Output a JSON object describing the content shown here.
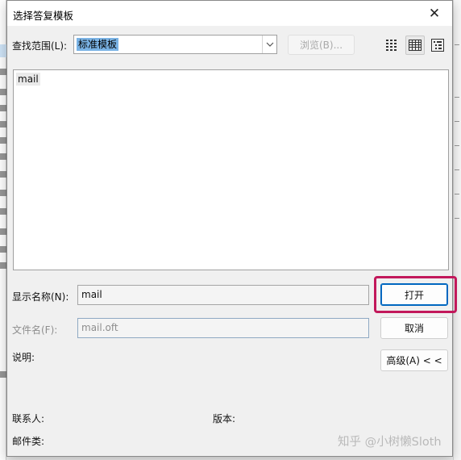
{
  "dialog": {
    "title": "选择答复模板",
    "close_glyph": "✕"
  },
  "lookin": {
    "label": "查找范围(L):",
    "selected": "标准模板",
    "browse_label": "浏览(B)..."
  },
  "view_buttons": [
    "list-view-icon",
    "details-view-icon",
    "tree-view-icon"
  ],
  "file_list": {
    "items": [
      "mail"
    ]
  },
  "display_name": {
    "label": "显示名称(N):",
    "value": "mail"
  },
  "file_name": {
    "label": "文件名(F):",
    "value": "mail.oft"
  },
  "buttons": {
    "open": "打开",
    "cancel": "取消",
    "advanced": "高级(A) < <"
  },
  "details": {
    "description_label": "说明:",
    "contact_label": "联系人:",
    "version_label": "版本:",
    "mailtype_label": "邮件类:"
  },
  "watermark": "知乎 @小树懒Sloth",
  "colors": {
    "highlight": "#c2185b",
    "selection": "#7ab3e5",
    "accent": "#0067c0"
  }
}
